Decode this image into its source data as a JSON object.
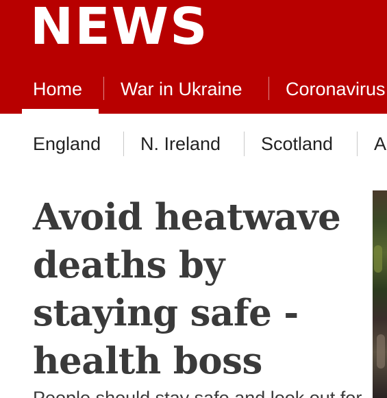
{
  "brand": {
    "logo_text": "NEWS",
    "header_color": "#b80000"
  },
  "main_nav": {
    "items": [
      {
        "label": "Home",
        "active": true
      },
      {
        "label": "War in Ukraine",
        "active": false
      },
      {
        "label": "Coronavirus",
        "active": false
      }
    ]
  },
  "sub_nav": {
    "items": [
      {
        "label": "England"
      },
      {
        "label": "N. Ireland"
      },
      {
        "label": "Scotland"
      },
      {
        "label": "A"
      }
    ]
  },
  "article": {
    "headline_lines": [
      "Avoid heatwave",
      "deaths by",
      "staying safe -",
      "health boss"
    ],
    "summary_partial": "People should stay safe and look out for"
  }
}
